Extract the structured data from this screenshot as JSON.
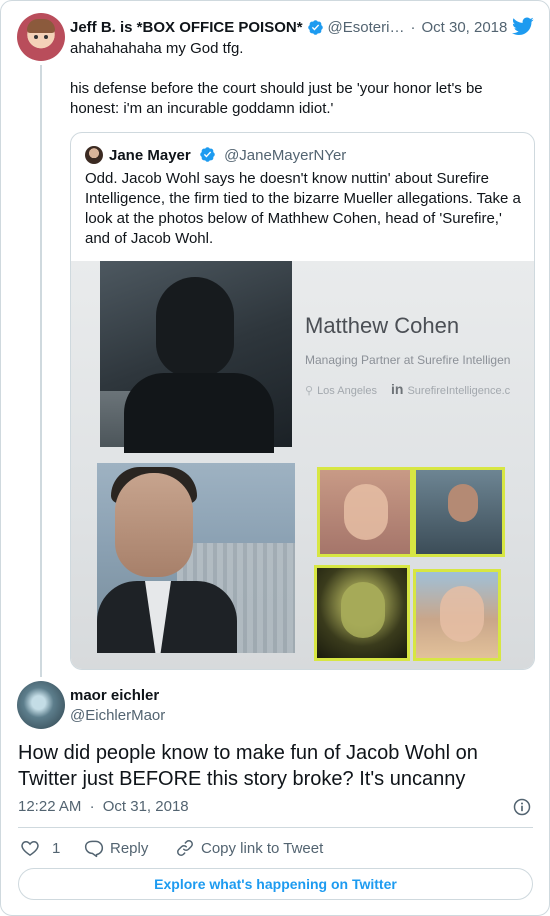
{
  "parent_tweet": {
    "display_name": "Jeff B. is *BOX OFFICE POISON*",
    "handle": "@Esoteri…",
    "separator": "·",
    "date": "Oct 30, 2018",
    "text_line1": "ahahahahaha my God tfg.",
    "text_line2": "his defense before the court should just be 'your honor let's be honest: i'm an incurable goddamn idiot.'"
  },
  "quoted_tweet": {
    "display_name": "Jane Mayer",
    "handle": "@JaneMayerNYer",
    "text": "Odd. Jacob Wohl says he doesn't know nuttin' about Surefire Intelligence, the firm tied to the bizarre Mueller allegations. Take a look at the photos below of Mathhew Cohen, head of 'Surefire,' and of Jacob Wohl.",
    "photo": {
      "profile_name": "Matthew Cohen",
      "profile_role": "Managing Partner at Surefire Intelligen",
      "location": "Los Angeles",
      "linkedin_glyph": "in",
      "website": "SurefireIntelligence.c"
    }
  },
  "reply_tweet": {
    "display_name": "maor eichler",
    "handle": "@EichlerMaor",
    "text": "How did people know to make fun of Jacob Wohl on Twitter just BEFORE this story broke? It's uncanny",
    "time": "12:22 AM",
    "separator": "·",
    "date": "Oct 31, 2018"
  },
  "actions": {
    "like_count": "1",
    "reply_label": "Reply",
    "copy_label": "Copy link to Tweet"
  },
  "explore_label": "Explore what's happening on Twitter",
  "colors": {
    "twitter_blue": "#1d9bf0",
    "muted_text": "#536471",
    "border": "#cfd9de",
    "highlight_frame": "#d7e643"
  },
  "icons": [
    "twitter-bird-icon",
    "verified-badge-icon",
    "heart-icon",
    "reply-icon",
    "link-icon",
    "info-icon"
  ]
}
